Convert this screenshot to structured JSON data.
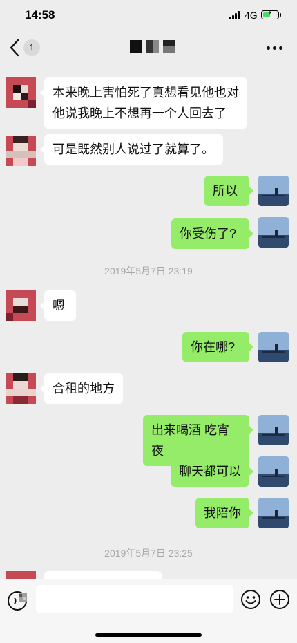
{
  "status_bar": {
    "time": "14:58",
    "network": "4G",
    "battery_level": 0.55
  },
  "nav": {
    "unread_count": "1"
  },
  "messages": [
    {
      "side": "left",
      "text_lines": [
        "本来晚上害怕死了真想看见他也对",
        "他说我晚上不想再一个人回去了"
      ]
    },
    {
      "side": "left",
      "text": "可是既然别人说过了就算了。"
    },
    {
      "side": "right",
      "text": "所以"
    },
    {
      "side": "right",
      "text": "你受伤了?"
    },
    {
      "type": "timestamp",
      "text": "2019年5月7日 23:19"
    },
    {
      "side": "left",
      "text": "嗯"
    },
    {
      "side": "right",
      "text": "你在哪?"
    },
    {
      "side": "left",
      "text": "合租的地方"
    },
    {
      "side": "right",
      "text": "出来喝酒 吃宵夜"
    },
    {
      "side": "right",
      "text": "聊天都可以"
    },
    {
      "side": "right",
      "text": "我陪你"
    },
    {
      "type": "timestamp",
      "text": "2019年5月7日 23:25"
    }
  ],
  "icons": {
    "back": "chevron-left-icon",
    "more": "more-dots-icon",
    "voice": "voice-icon",
    "emoji": "emoji-icon",
    "plus": "plus-icon"
  },
  "colors": {
    "background": "#ededed",
    "bubble_self": "#95ec69",
    "bubble_other": "#ffffff",
    "timestamp": "#a7a7a7"
  }
}
